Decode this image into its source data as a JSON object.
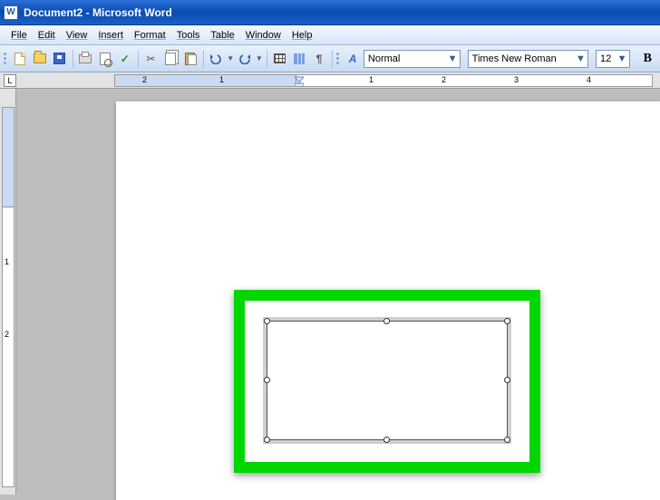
{
  "window": {
    "title": "Document2 - Microsoft Word"
  },
  "menus": {
    "file": "File",
    "edit": "Edit",
    "view": "View",
    "insert": "Insert",
    "format": "Format",
    "tools": "Tools",
    "table": "Table",
    "window": "Window",
    "help": "Help"
  },
  "toolbar": {
    "spell_glyph": "✓"
  },
  "formatting": {
    "style_label": "Normal",
    "font_label": "Times New Roman",
    "size_label": "12",
    "bold_glyph": "B",
    "style_glyph": "A"
  },
  "ruler": {
    "tab_marker": "L",
    "h_numbers": [
      "2",
      "1",
      "1",
      "2",
      "3",
      "4"
    ]
  },
  "vruler": {
    "numbers": [
      "1",
      "2"
    ]
  }
}
